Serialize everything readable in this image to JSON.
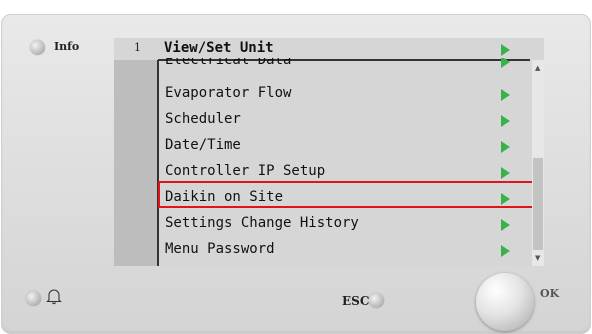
{
  "info_label": "Info",
  "line_number": "1",
  "menu_title": "View/Set Unit",
  "menu_items": [
    {
      "label": "Electrical Data"
    },
    {
      "label": "Evaporator Flow"
    },
    {
      "label": "Scheduler"
    },
    {
      "label": "Date/Time"
    },
    {
      "label": "Controller IP Setup"
    },
    {
      "label": "Daikin on Site",
      "highlighted": true
    },
    {
      "label": "Settings Change History"
    },
    {
      "label": "Menu Password"
    }
  ],
  "esc_label": "ESC",
  "ok_label": "OK",
  "icons": {
    "info": "led-indicator-icon",
    "alarm": "bell-icon",
    "arrow": "play-arrow-icon"
  },
  "colors": {
    "arrow": "#39b24a",
    "highlight_border": "#e0141b"
  }
}
